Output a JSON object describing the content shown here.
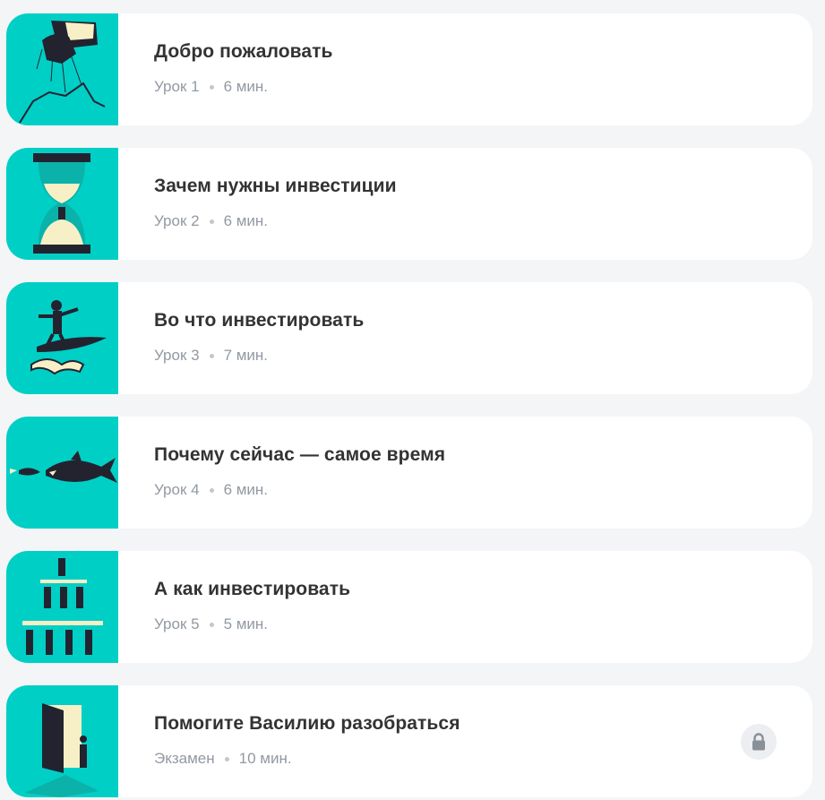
{
  "lessons": [
    {
      "title": "Добро пожаловать",
      "kind": "Урок 1",
      "duration": "6 мин.",
      "icon": "puppeteer-hand-icon",
      "locked": false
    },
    {
      "title": "Зачем нужны инвестиции",
      "kind": "Урок 2",
      "duration": "6 мин.",
      "icon": "hourglass-icon",
      "locked": false
    },
    {
      "title": "Во что инвестировать",
      "kind": "Урок 3",
      "duration": "7 мин.",
      "icon": "surfer-icon",
      "locked": false
    },
    {
      "title": "Почему сейчас — самое время",
      "kind": "Урок 4",
      "duration": "6 мин.",
      "icon": "shark-icon",
      "locked": false
    },
    {
      "title": "А как инвестировать",
      "kind": "Урок 5",
      "duration": "5 мин.",
      "icon": "pyramid-people-icon",
      "locked": false
    },
    {
      "title": "Помогите Василию разобраться",
      "kind": "Экзамен",
      "duration": "10 мин.",
      "icon": "door-icon",
      "locked": true
    }
  ],
  "colors": {
    "accent": "#00cfc6",
    "ink": "#232330",
    "cream": "#f7f0c6"
  }
}
